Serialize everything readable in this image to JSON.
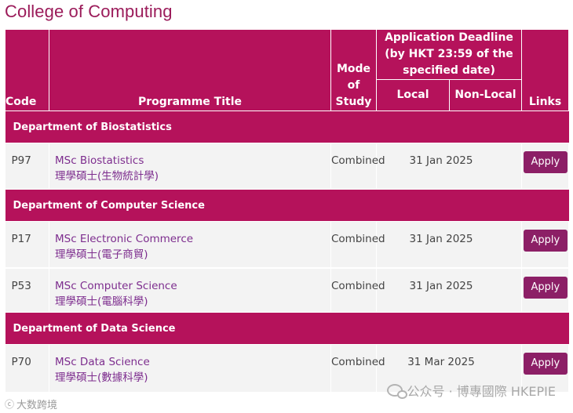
{
  "page": {
    "title": "College of Computing"
  },
  "table": {
    "headers": {
      "code": "Code",
      "programme_title": "Programme Title",
      "mode": "Mode of Study",
      "deadline": "Application Deadline (by HKT 23:59 of the specified date)",
      "local": "Local",
      "non_local": "Non-Local",
      "links": "Links"
    },
    "groups": [
      {
        "department": "Department of Biostatistics",
        "rows": [
          {
            "code": "P97",
            "title_en": "MSc Biostatistics",
            "title_zh": "理學碩士(生物統計學)",
            "mode": "Combined",
            "deadline": "31 Jan 2025",
            "link": "Apply"
          }
        ]
      },
      {
        "department": "Department of Computer Science",
        "rows": [
          {
            "code": "P17",
            "title_en": "MSc Electronic Commerce",
            "title_zh": "理學碩士(電子商貿)",
            "mode": "Combined",
            "deadline": "31 Jan 2025",
            "link": "Apply"
          },
          {
            "code": "P53",
            "title_en": "MSc Computer Science",
            "title_zh": "理學碩士(電腦科學)",
            "mode": "Combined",
            "deadline": "31 Jan 2025",
            "link": "Apply"
          }
        ]
      },
      {
        "department": "Department of Data Science",
        "rows": [
          {
            "code": "P70",
            "title_en": "MSc Data Science",
            "title_zh": "理學碩士(數據科學)",
            "mode": "Combined",
            "deadline": "31 Mar 2025",
            "link": "Apply"
          }
        ]
      }
    ]
  },
  "watermark": {
    "text": "公众号 · 博專國際 HKEPIE",
    "icon": "wechat-icon"
  },
  "footer_mark": {
    "text": "大数跨境",
    "icon": "brand-mark-icon"
  }
}
